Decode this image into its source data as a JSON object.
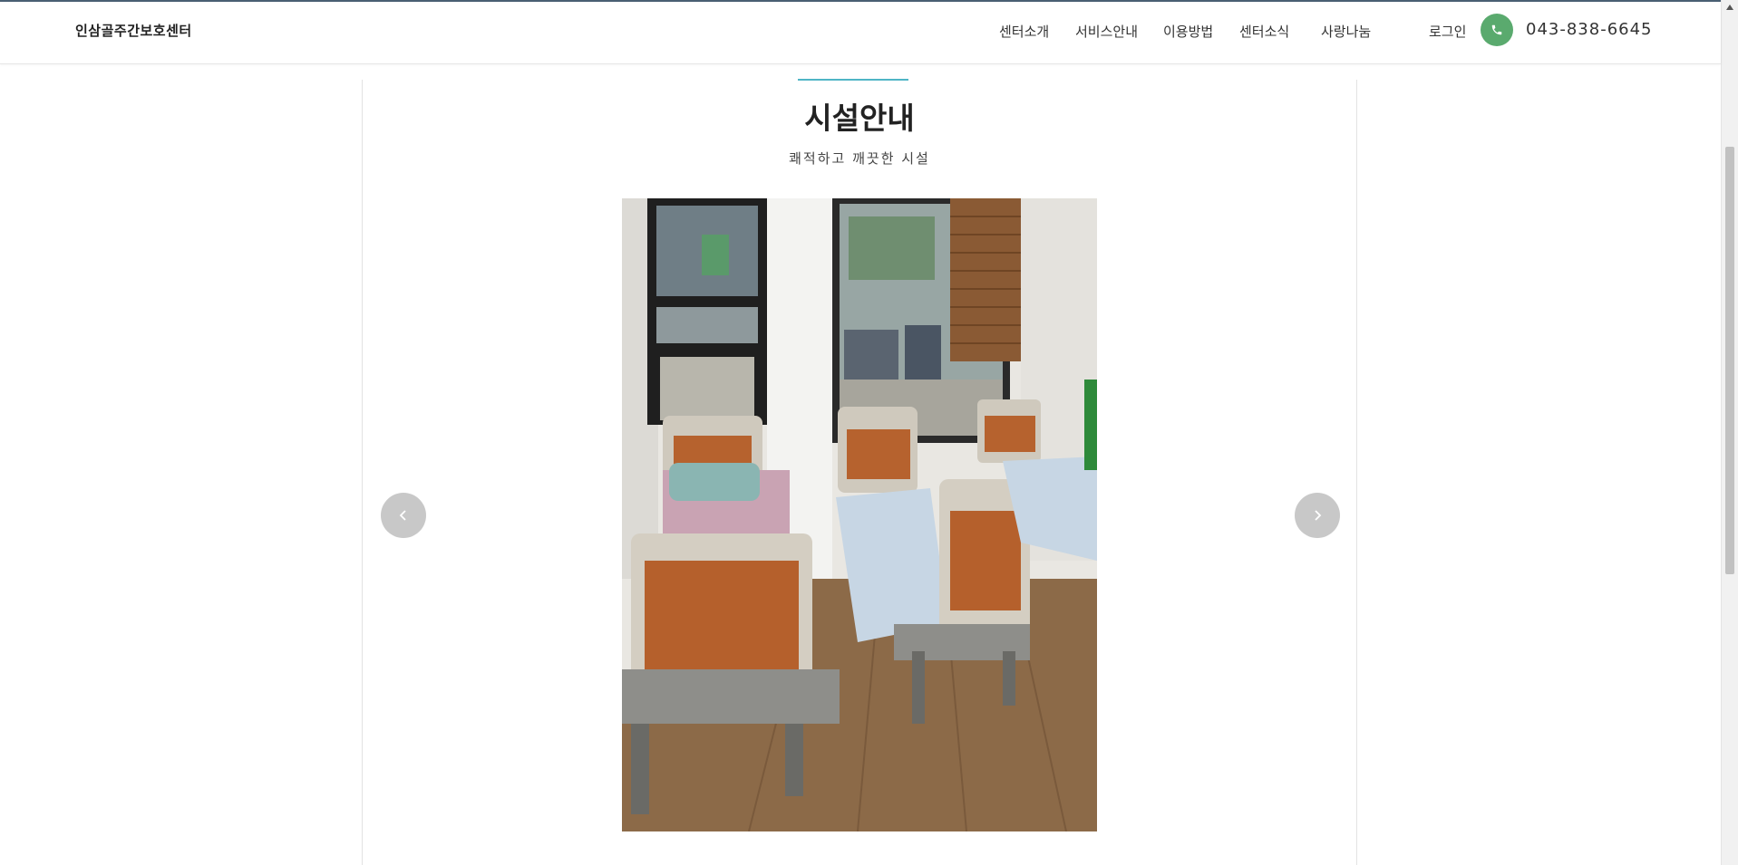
{
  "header": {
    "brand": "인삼골주간보호센터",
    "nav": [
      "센터소개",
      "서비스안내",
      "이용방법",
      "센터소식",
      "사랑나눔"
    ],
    "login": "로그인",
    "phone": "043-838-6645",
    "phone_icon": "phone-icon"
  },
  "section": {
    "title": "시설안내",
    "subtitle": "쾌적하고 깨끗한 시설"
  },
  "slider": {
    "prev_icon": "chevron-left-icon",
    "next_icon": "chevron-right-icon"
  },
  "colors": {
    "accent": "#4fb5c6",
    "phone_button": "#5aaa6e",
    "arrow_button": "#c8c8c8"
  }
}
